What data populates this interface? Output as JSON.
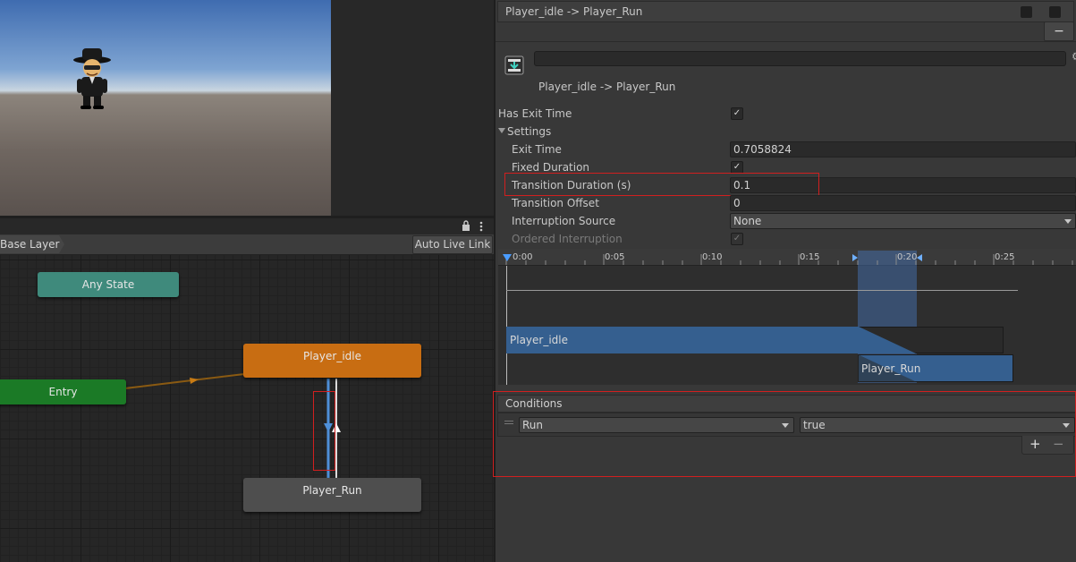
{
  "scene": {
    "character_icon": "character-sprite"
  },
  "animator": {
    "breadcrumb": "Base Layer",
    "auto_live_link": "Auto Live Link",
    "lock_icon": "lock-icon",
    "menu_icon": "kebab-menu-icon",
    "nodes": {
      "any_state": "Any State",
      "player_idle": "Player_idle",
      "entry": "Entry",
      "player_run": "Player_Run"
    }
  },
  "inspector": {
    "header_title": "Player_idle -> Player_Run",
    "minus_label": "−",
    "transition_name": "Player_idle -> Player_Run",
    "has_exit_time_label": "Has Exit Time",
    "settings_label": "Settings",
    "exit_time_label": "Exit Time",
    "exit_time_value": "0.7058824",
    "fixed_duration_label": "Fixed Duration",
    "transition_duration_label": "Transition Duration (s)",
    "transition_duration_value": "0.1",
    "transition_offset_label": "Transition Offset",
    "transition_offset_value": "0",
    "interruption_source_label": "Interruption Source",
    "interruption_source_value": "None",
    "ordered_interruption_label": "Ordered Interruption",
    "checkmark": "✓",
    "timeline": {
      "ticks": [
        "0:00",
        "0:05",
        "0:10",
        "0:15",
        "0:20",
        "0:25"
      ],
      "clip_from": "Player_idle",
      "clip_to": "Player_Run"
    },
    "conditions": {
      "header": "Conditions",
      "parameter": "Run",
      "value": "true",
      "add_label": "+",
      "remove_label": "−"
    }
  },
  "colors": {
    "idle_node": "#c86d12",
    "entry_node": "#1b7a26",
    "any_state_node": "#3f8a7c",
    "run_node": "#505050",
    "highlight": "#d11f1f",
    "timeline_blue": "#355f8f"
  }
}
